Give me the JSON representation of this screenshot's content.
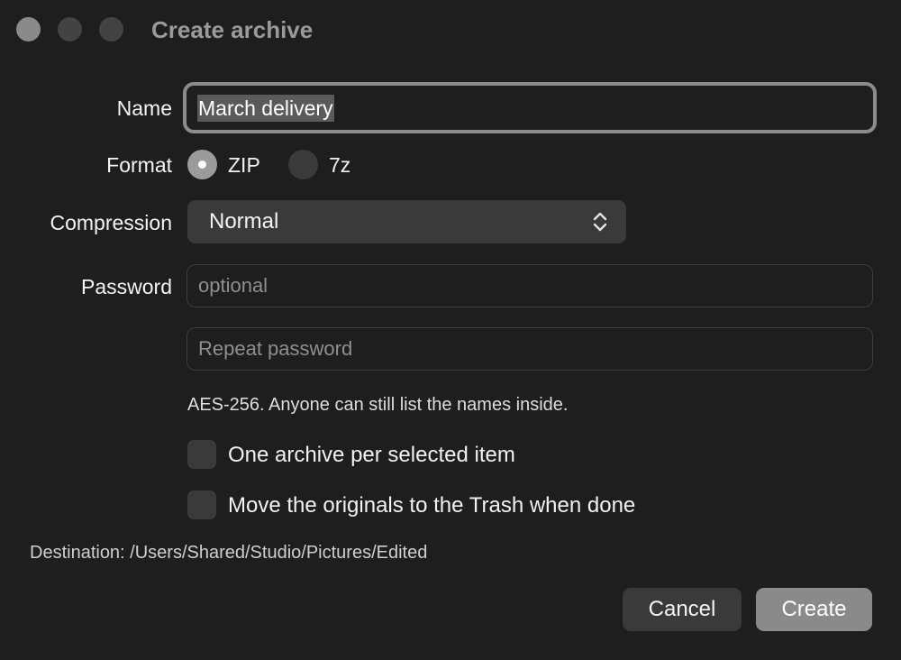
{
  "window": {
    "title": "Create archive"
  },
  "form": {
    "name_label": "Name",
    "name_value": "March delivery",
    "format_label": "Format",
    "format_options": [
      {
        "label": "ZIP",
        "selected": true
      },
      {
        "label": "7z",
        "selected": false
      }
    ],
    "compression_label": "Compression",
    "compression_value": "Normal",
    "password_label": "Password",
    "password_placeholder": "optional",
    "repeat_placeholder": "Repeat password",
    "password_hint": "AES-256. Anyone can still list the names inside.",
    "options": [
      {
        "label": "One archive per selected item",
        "checked": false
      },
      {
        "label": "Move the originals to the Trash when done",
        "checked": false
      }
    ],
    "destination": "Destination: /Users/Shared/Studio/Pictures/Edited"
  },
  "buttons": {
    "cancel_label": "Cancel",
    "create_label": "Create"
  },
  "icons": {
    "popup": "chevron-up-down-icon"
  },
  "colors": {
    "background": "#1e1e1e",
    "control": "#3a3a3a",
    "accent": "#8a8a8a"
  }
}
